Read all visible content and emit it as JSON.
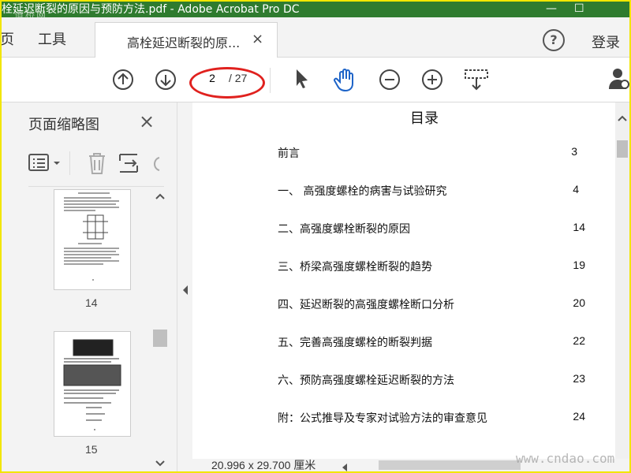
{
  "window": {
    "title": "高栓延迟断裂的原因与预防方法.pdf - Adobe Acrobat Pro DC",
    "minimize": "—",
    "maximize": "☐",
    "watermark_top": "道桥网"
  },
  "menu": {
    "home_partial": "页",
    "tools": "工具",
    "tab_label": "高栓延迟断裂的原...",
    "tab_close": "×",
    "help": "?",
    "login": "登录"
  },
  "toolbar": {
    "current_page": "2",
    "total_pages": "/ 27",
    "icons": [
      "arrow-up-circle-icon",
      "arrow-down-circle-icon",
      "pointer-icon",
      "hand-icon",
      "zoom-out-icon",
      "zoom-in-icon",
      "marquee-zoom-icon",
      "share-user-icon"
    ],
    "accent": "#1e64c8",
    "highlight": "#e0211e"
  },
  "panel": {
    "title": "页面缩略图",
    "close": "×",
    "thumbnails": [
      {
        "label": "14"
      },
      {
        "label": "15"
      }
    ]
  },
  "document": {
    "heading": "目录",
    "toc": [
      {
        "text": "前言",
        "page": "3"
      },
      {
        "text": "一、 高强度螺栓的病害与试验研究",
        "page": "4"
      },
      {
        "text": "二、高强度螺栓断裂的原因",
        "page": "14"
      },
      {
        "text": "三、桥梁高强度螺栓断裂的趋势",
        "page": "19"
      },
      {
        "text": "四、延迟断裂的高强度螺栓断口分析",
        "page": "20"
      },
      {
        "text": "五、完善高强度螺栓的断裂判据",
        "page": "22"
      },
      {
        "text": "六、预防高强度螺栓延迟断裂的方法",
        "page": "23"
      },
      {
        "text": "附：公式推导及专家对试验方法的审查意见",
        "page": "24"
      }
    ]
  },
  "status": {
    "page_size": "20.996 x 29.700 厘米"
  },
  "watermark": "www.cndao.com"
}
